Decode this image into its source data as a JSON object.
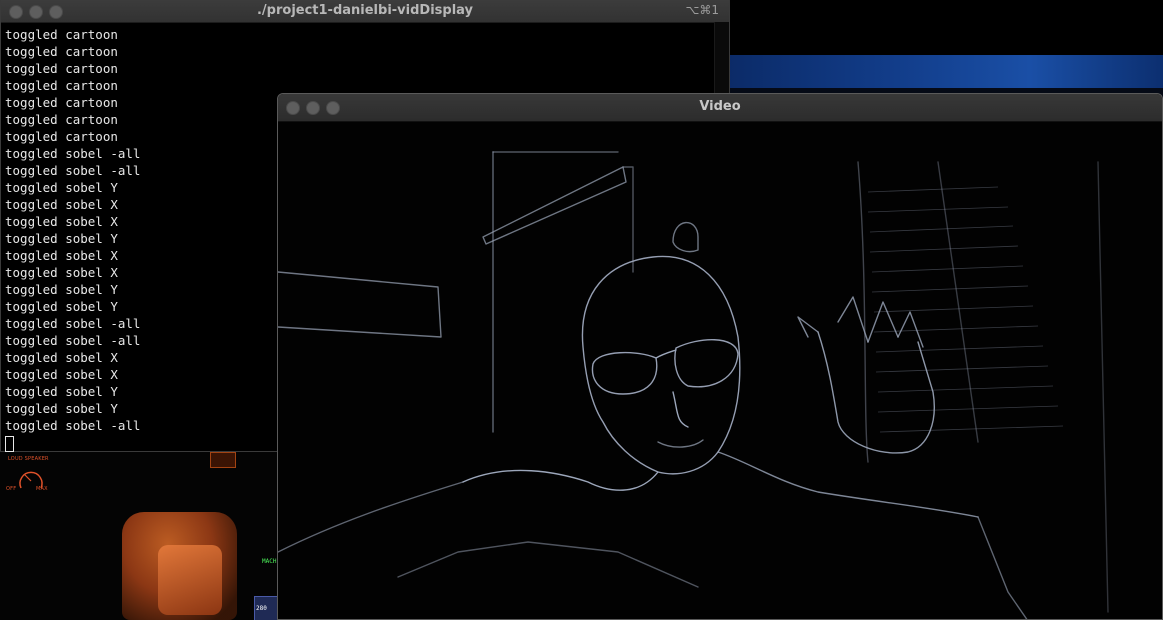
{
  "terminal": {
    "title": "./project1-danielbi-vidDisplay",
    "shortcut": "⌥⌘1",
    "lines": [
      "toggled cartoon",
      "toggled cartoon",
      "toggled cartoon",
      "toggled cartoon",
      "toggled cartoon",
      "toggled cartoon",
      "toggled cartoon",
      "toggled sobel -all",
      "toggled sobel -all",
      "toggled sobel Y",
      "toggled sobel X",
      "toggled sobel X",
      "toggled sobel Y",
      "toggled sobel X",
      "toggled sobel X",
      "toggled sobel Y",
      "toggled sobel Y",
      "toggled sobel -all",
      "toggled sobel -all",
      "toggled sobel X",
      "toggled sobel X",
      "toggled sobel Y",
      "toggled sobel Y",
      "toggled sobel -all"
    ]
  },
  "video": {
    "title": "Video"
  },
  "background": {
    "speaker_label": "LOUD SPEAKER",
    "off_label": "OFF",
    "max_label": "MAX",
    "mach_label": "MACH",
    "speed_value": "280"
  },
  "colors": {
    "traffic_light": "#5e5e5e",
    "terminal_text": "#e8e8e8",
    "edge_glow": "#b8c4dc"
  }
}
